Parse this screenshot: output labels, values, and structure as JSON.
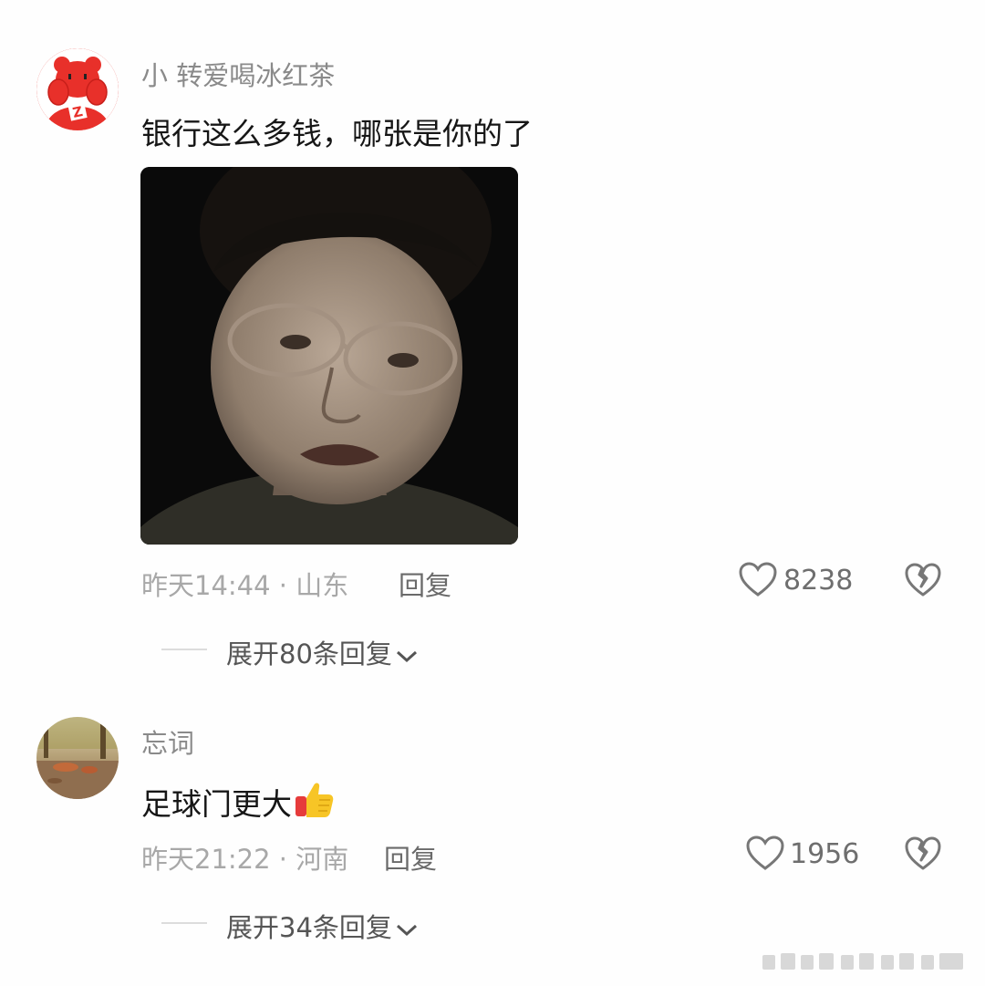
{
  "comments": [
    {
      "username": "小 转爱喝冰红茶",
      "text": "银行这么多钱，哪张是你的了",
      "time_location": "昨天14:44 · 山东",
      "reply_label": "回复",
      "likes": "8238",
      "expand_label": "展开80条回复",
      "avatar_icon": "red-bear-avatar",
      "has_sticker": true
    },
    {
      "username": "忘词",
      "text": "足球门更大",
      "emoji": "thumbs-up",
      "time_location": "昨天21:22 · 河南",
      "reply_label": "回复",
      "likes": "1956",
      "expand_label": "展开34条回复",
      "avatar_icon": "autumn-leaves-avatar"
    }
  ],
  "colors": {
    "background": "#fefefe",
    "avatar_red": "#e8302a"
  }
}
